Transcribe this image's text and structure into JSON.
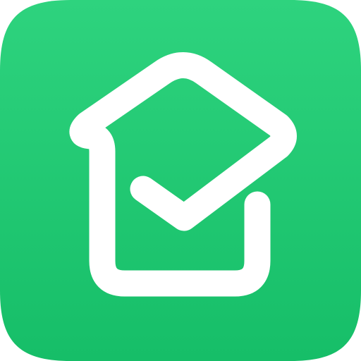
{
  "icon": {
    "name": "house-check-app-icon",
    "colors": {
      "background_top": "#2ED37E",
      "background_bottom": "#16BE68",
      "glyph": "#FFFFFF"
    }
  }
}
